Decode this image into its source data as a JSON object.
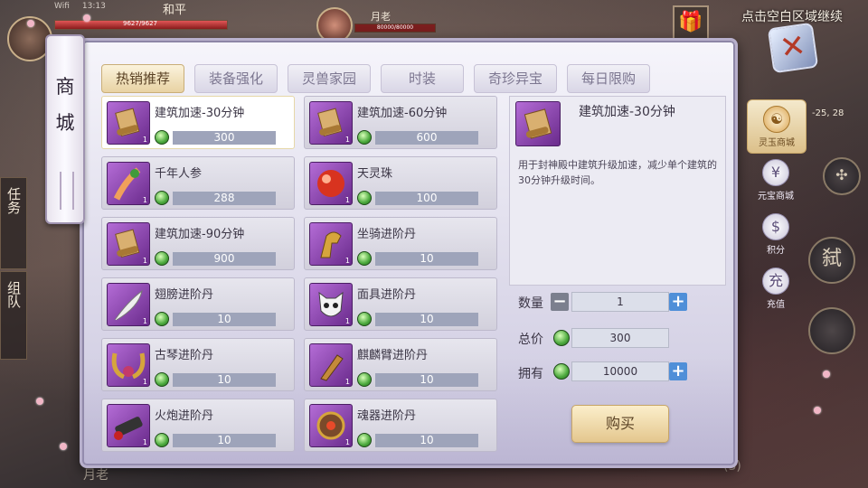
{
  "status": {
    "wifi": "Wifi",
    "time": "13:13"
  },
  "hud": {
    "zone": "和平",
    "hp_text": "9627/9627",
    "target_name": "月老",
    "target_hp": "80000/80000",
    "hint": "点击空白区域继续",
    "coords": "-25, 28",
    "side_tabs": [
      "任务",
      "组队"
    ],
    "skill_glyph": "弑",
    "bottom_chat": "月老",
    "bottom_right": "(3)"
  },
  "shop": {
    "title": [
      "商",
      "城"
    ],
    "close_glyph": "✕",
    "tabs": [
      "热销推荐",
      "装备强化",
      "灵兽家园",
      "时装",
      "奇珍异宝",
      "每日限购"
    ],
    "active_tab": 0,
    "items": [
      {
        "name": "建筑加速-30分钟",
        "price": "300",
        "icon": "scroll-icon",
        "count": "1"
      },
      {
        "name": "建筑加速-60分钟",
        "price": "600",
        "icon": "scroll-icon",
        "count": "1"
      },
      {
        "name": "千年人参",
        "price": "288",
        "icon": "ginseng-icon",
        "count": "1"
      },
      {
        "name": "天灵珠",
        "price": "100",
        "icon": "red-orb-icon",
        "count": "1"
      },
      {
        "name": "建筑加速-90分钟",
        "price": "900",
        "icon": "scroll-icon",
        "count": "1"
      },
      {
        "name": "坐骑进阶丹",
        "price": "10",
        "icon": "horse-head-icon",
        "count": "1"
      },
      {
        "name": "翅膀进阶丹",
        "price": "10",
        "icon": "feather-icon",
        "count": "1"
      },
      {
        "name": "面具进阶丹",
        "price": "10",
        "icon": "mask-icon",
        "count": "1"
      },
      {
        "name": "古琴进阶丹",
        "price": "10",
        "icon": "horns-icon",
        "count": "1"
      },
      {
        "name": "麒麟臂进阶丹",
        "price": "10",
        "icon": "gauntlet-icon",
        "count": "1"
      },
      {
        "name": "火炮进阶丹",
        "price": "10",
        "icon": "cannon-icon",
        "count": "1"
      },
      {
        "name": "魂器进阶丹",
        "price": "10",
        "icon": "soul-vessel-icon",
        "count": "1"
      }
    ],
    "detail": {
      "name": "建筑加速-30分钟",
      "description": "用于封神殿中建筑升级加速，减少单个建筑的30分钟升级时间。",
      "qty_label": "数量",
      "qty": "1",
      "total_label": "总价",
      "total": "300",
      "own_label": "拥有",
      "own": "10000",
      "buy_label": "购买"
    },
    "side_nav": [
      {
        "label": "灵玉商城",
        "glyph": "☯",
        "active": true
      },
      {
        "label": "元宝商城",
        "glyph": "¥",
        "active": false
      },
      {
        "label": "积分",
        "glyph": "$",
        "active": false
      },
      {
        "label": "充值",
        "glyph": "充",
        "active": false
      }
    ]
  }
}
